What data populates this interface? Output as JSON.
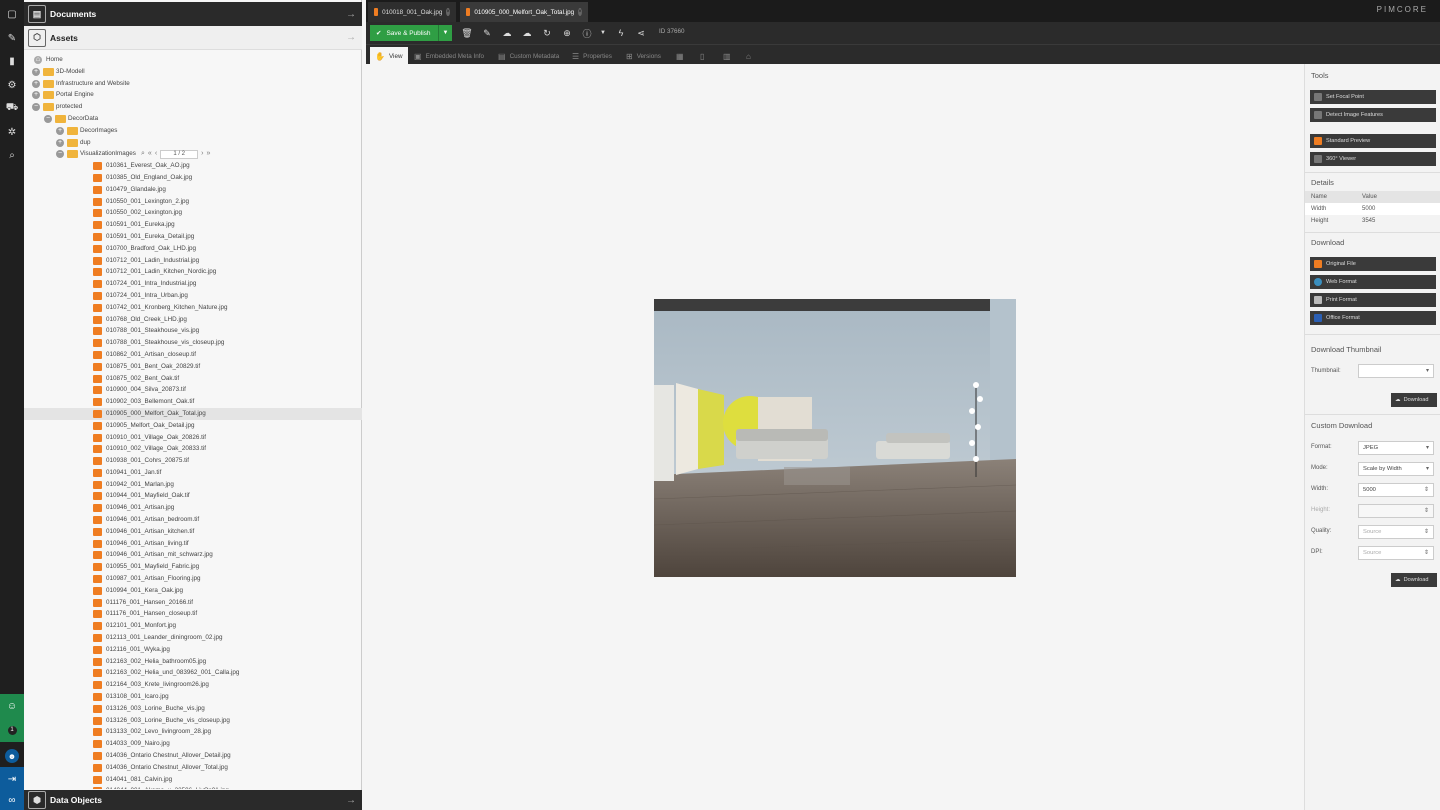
{
  "nav": {
    "badge": "1"
  },
  "tree": {
    "documents_label": "Documents",
    "assets_label": "Assets",
    "data_objects_label": "Data Objects",
    "pager_value": "1",
    "pager_total": "2",
    "nodes": [
      {
        "label": "Home",
        "depth": 0,
        "kind": "home"
      },
      {
        "label": "3D-Modell",
        "depth": 1,
        "kind": "folder",
        "exp": "+"
      },
      {
        "label": "Infrastructure and Website",
        "depth": 1,
        "kind": "folder",
        "exp": "+"
      },
      {
        "label": "Portal Engine",
        "depth": 1,
        "kind": "folder",
        "exp": "+"
      },
      {
        "label": "protected",
        "depth": 1,
        "kind": "folder",
        "exp": "-"
      },
      {
        "label": "DecorData",
        "depth": 2,
        "kind": "folder",
        "exp": "-"
      },
      {
        "label": "DecorImages",
        "depth": 3,
        "kind": "folder",
        "exp": "+"
      },
      {
        "label": "dup",
        "depth": 3,
        "kind": "folder",
        "exp": "+"
      },
      {
        "label": "VisualizationImages",
        "depth": 3,
        "kind": "folder",
        "exp": "-",
        "pager": true
      },
      {
        "label": "010361_Everest_Oak_AO.jpg",
        "depth": 4,
        "kind": "img"
      },
      {
        "label": "010385_Old_England_Oak.jpg",
        "depth": 4,
        "kind": "img"
      },
      {
        "label": "010479_Glandale.jpg",
        "depth": 4,
        "kind": "img"
      },
      {
        "label": "010550_001_Lexington_2.jpg",
        "depth": 4,
        "kind": "img"
      },
      {
        "label": "010550_002_Lexington.jpg",
        "depth": 4,
        "kind": "img"
      },
      {
        "label": "010591_001_Eureka.jpg",
        "depth": 4,
        "kind": "img"
      },
      {
        "label": "010591_001_Eureka_Detail.jpg",
        "depth": 4,
        "kind": "img"
      },
      {
        "label": "010700_Bradford_Oak_LHD.jpg",
        "depth": 4,
        "kind": "img"
      },
      {
        "label": "010712_001_Ladin_Industrial.jpg",
        "depth": 4,
        "kind": "img"
      },
      {
        "label": "010712_001_Ladin_Kitchen_Nordic.jpg",
        "depth": 4,
        "kind": "img"
      },
      {
        "label": "010724_001_Intra_Industrial.jpg",
        "depth": 4,
        "kind": "img"
      },
      {
        "label": "010724_001_Intra_Urban.jpg",
        "depth": 4,
        "kind": "img"
      },
      {
        "label": "010742_001_Kronberg_Kitchen_Nature.jpg",
        "depth": 4,
        "kind": "img"
      },
      {
        "label": "010768_Old_Creek_LHD.jpg",
        "depth": 4,
        "kind": "img"
      },
      {
        "label": "010788_001_Steakhouse_vis.jpg",
        "depth": 4,
        "kind": "img"
      },
      {
        "label": "010788_001_Steakhouse_vis_closeup.jpg",
        "depth": 4,
        "kind": "img"
      },
      {
        "label": "010862_001_Artisan_closeup.tif",
        "depth": 4,
        "kind": "img"
      },
      {
        "label": "010875_001_Bent_Oak_20829.tif",
        "depth": 4,
        "kind": "img"
      },
      {
        "label": "010875_002_Bent_Oak.tif",
        "depth": 4,
        "kind": "img"
      },
      {
        "label": "010900_004_Silva_20873.tif",
        "depth": 4,
        "kind": "img"
      },
      {
        "label": "010902_003_Bellemont_Oak.tif",
        "depth": 4,
        "kind": "img"
      },
      {
        "label": "010905_000_Melfort_Oak_Total.jpg",
        "depth": 4,
        "kind": "img",
        "selected": true
      },
      {
        "label": "010905_Melfort_Oak_Detail.jpg",
        "depth": 4,
        "kind": "img"
      },
      {
        "label": "010910_001_Village_Oak_20826.tif",
        "depth": 4,
        "kind": "img"
      },
      {
        "label": "010910_002_Village_Oak_20833.tif",
        "depth": 4,
        "kind": "img"
      },
      {
        "label": "010938_001_Cohrs_20875.tif",
        "depth": 4,
        "kind": "img"
      },
      {
        "label": "010941_001_Jan.tif",
        "depth": 4,
        "kind": "img"
      },
      {
        "label": "010942_001_Marlan.jpg",
        "depth": 4,
        "kind": "img"
      },
      {
        "label": "010944_001_Mayfield_Oak.tif",
        "depth": 4,
        "kind": "img"
      },
      {
        "label": "010946_001_Artisan.jpg",
        "depth": 4,
        "kind": "img"
      },
      {
        "label": "010946_001_Artisan_bedroom.tif",
        "depth": 4,
        "kind": "img"
      },
      {
        "label": "010946_001_Artisan_kitchen.tif",
        "depth": 4,
        "kind": "img"
      },
      {
        "label": "010946_001_Artisan_living.tif",
        "depth": 4,
        "kind": "img"
      },
      {
        "label": "010946_001_Artisan_mit_schwarz.jpg",
        "depth": 4,
        "kind": "img"
      },
      {
        "label": "010955_001_Mayfield_Fabric.jpg",
        "depth": 4,
        "kind": "img"
      },
      {
        "label": "010987_001_Artisan_Flooring.jpg",
        "depth": 4,
        "kind": "img"
      },
      {
        "label": "010994_001_Kera_Oak.jpg",
        "depth": 4,
        "kind": "img"
      },
      {
        "label": "011176_001_Hansen_20166.tif",
        "depth": 4,
        "kind": "img"
      },
      {
        "label": "011176_001_Hansen_closeup.tif",
        "depth": 4,
        "kind": "img"
      },
      {
        "label": "012101_001_Monfort.jpg",
        "depth": 4,
        "kind": "img"
      },
      {
        "label": "012113_001_Leander_diningroom_02.jpg",
        "depth": 4,
        "kind": "img"
      },
      {
        "label": "012116_001_Wyka.jpg",
        "depth": 4,
        "kind": "img"
      },
      {
        "label": "012163_002_Helia_bathroom05.jpg",
        "depth": 4,
        "kind": "img"
      },
      {
        "label": "012163_002_Helia_und_083962_001_Calla.jpg",
        "depth": 4,
        "kind": "img"
      },
      {
        "label": "012164_003_Krete_livingroom26.jpg",
        "depth": 4,
        "kind": "img"
      },
      {
        "label": "013108_001_Icaro.jpg",
        "depth": 4,
        "kind": "img"
      },
      {
        "label": "013126_003_Lorine_Buche_vis.jpg",
        "depth": 4,
        "kind": "img"
      },
      {
        "label": "013126_003_Lorine_Buche_vis_closeup.jpg",
        "depth": 4,
        "kind": "img"
      },
      {
        "label": "013133_002_Levo_livingroom_28.jpg",
        "depth": 4,
        "kind": "img"
      },
      {
        "label": "014033_009_Nairo.jpg",
        "depth": 4,
        "kind": "img"
      },
      {
        "label": "014036_Ontario Chestnut_Allover_Detail.jpg",
        "depth": 4,
        "kind": "img"
      },
      {
        "label": "014036_Ontario Chestnut_Allover_Total.jpg",
        "depth": 4,
        "kind": "img"
      },
      {
        "label": "014041_081_Calvin.jpg",
        "depth": 4,
        "kind": "img"
      },
      {
        "label": "014044_001_Akama_u_32596_LivOs01.jpg",
        "depth": 4,
        "kind": "img"
      }
    ]
  },
  "tabs": [
    {
      "label": "010018_001_Oak.jpg"
    },
    {
      "label": "010905_000_Melfort_Oak_Total.jpg"
    }
  ],
  "brand": "PIMCORE",
  "toolbar": {
    "save_label": "Save & Publish",
    "id_label": "ID 37660"
  },
  "subtabs": [
    {
      "label": "View"
    },
    {
      "label": "Embedded Meta Info"
    },
    {
      "label": "Custom Metadata"
    },
    {
      "label": "Properties"
    },
    {
      "label": "Versions"
    }
  ],
  "sidebar": {
    "tools_title": "Tools",
    "tools": [
      "Set Focal Point",
      "Detect Image Features"
    ],
    "preview_buttons": [
      "Standard Preview",
      "360° Viewer"
    ],
    "details_title": "Details",
    "details_header": {
      "name": "Name",
      "value": "Value"
    },
    "details": [
      {
        "name": "Width",
        "value": "5000"
      },
      {
        "name": "Height",
        "value": "3545"
      }
    ],
    "download_title": "Download",
    "downloads": [
      "Original File",
      "Web Format",
      "Print Format",
      "Office Format"
    ],
    "thumb_title": "Download Thumbnail",
    "thumb_label": "Thumbnail:",
    "download_btn": "Download",
    "custom_title": "Custom Download",
    "custom_fields": [
      {
        "label": "Format:",
        "value": "JPEG",
        "kind": "select"
      },
      {
        "label": "Mode:",
        "value": "Scale by Width",
        "kind": "select"
      },
      {
        "label": "Width:",
        "value": "5000",
        "kind": "number"
      },
      {
        "label": "Height:",
        "value": "",
        "kind": "disabled"
      },
      {
        "label": "Quality:",
        "value": "Source",
        "kind": "number"
      },
      {
        "label": "DPI:",
        "value": "Source",
        "kind": "number"
      }
    ]
  }
}
